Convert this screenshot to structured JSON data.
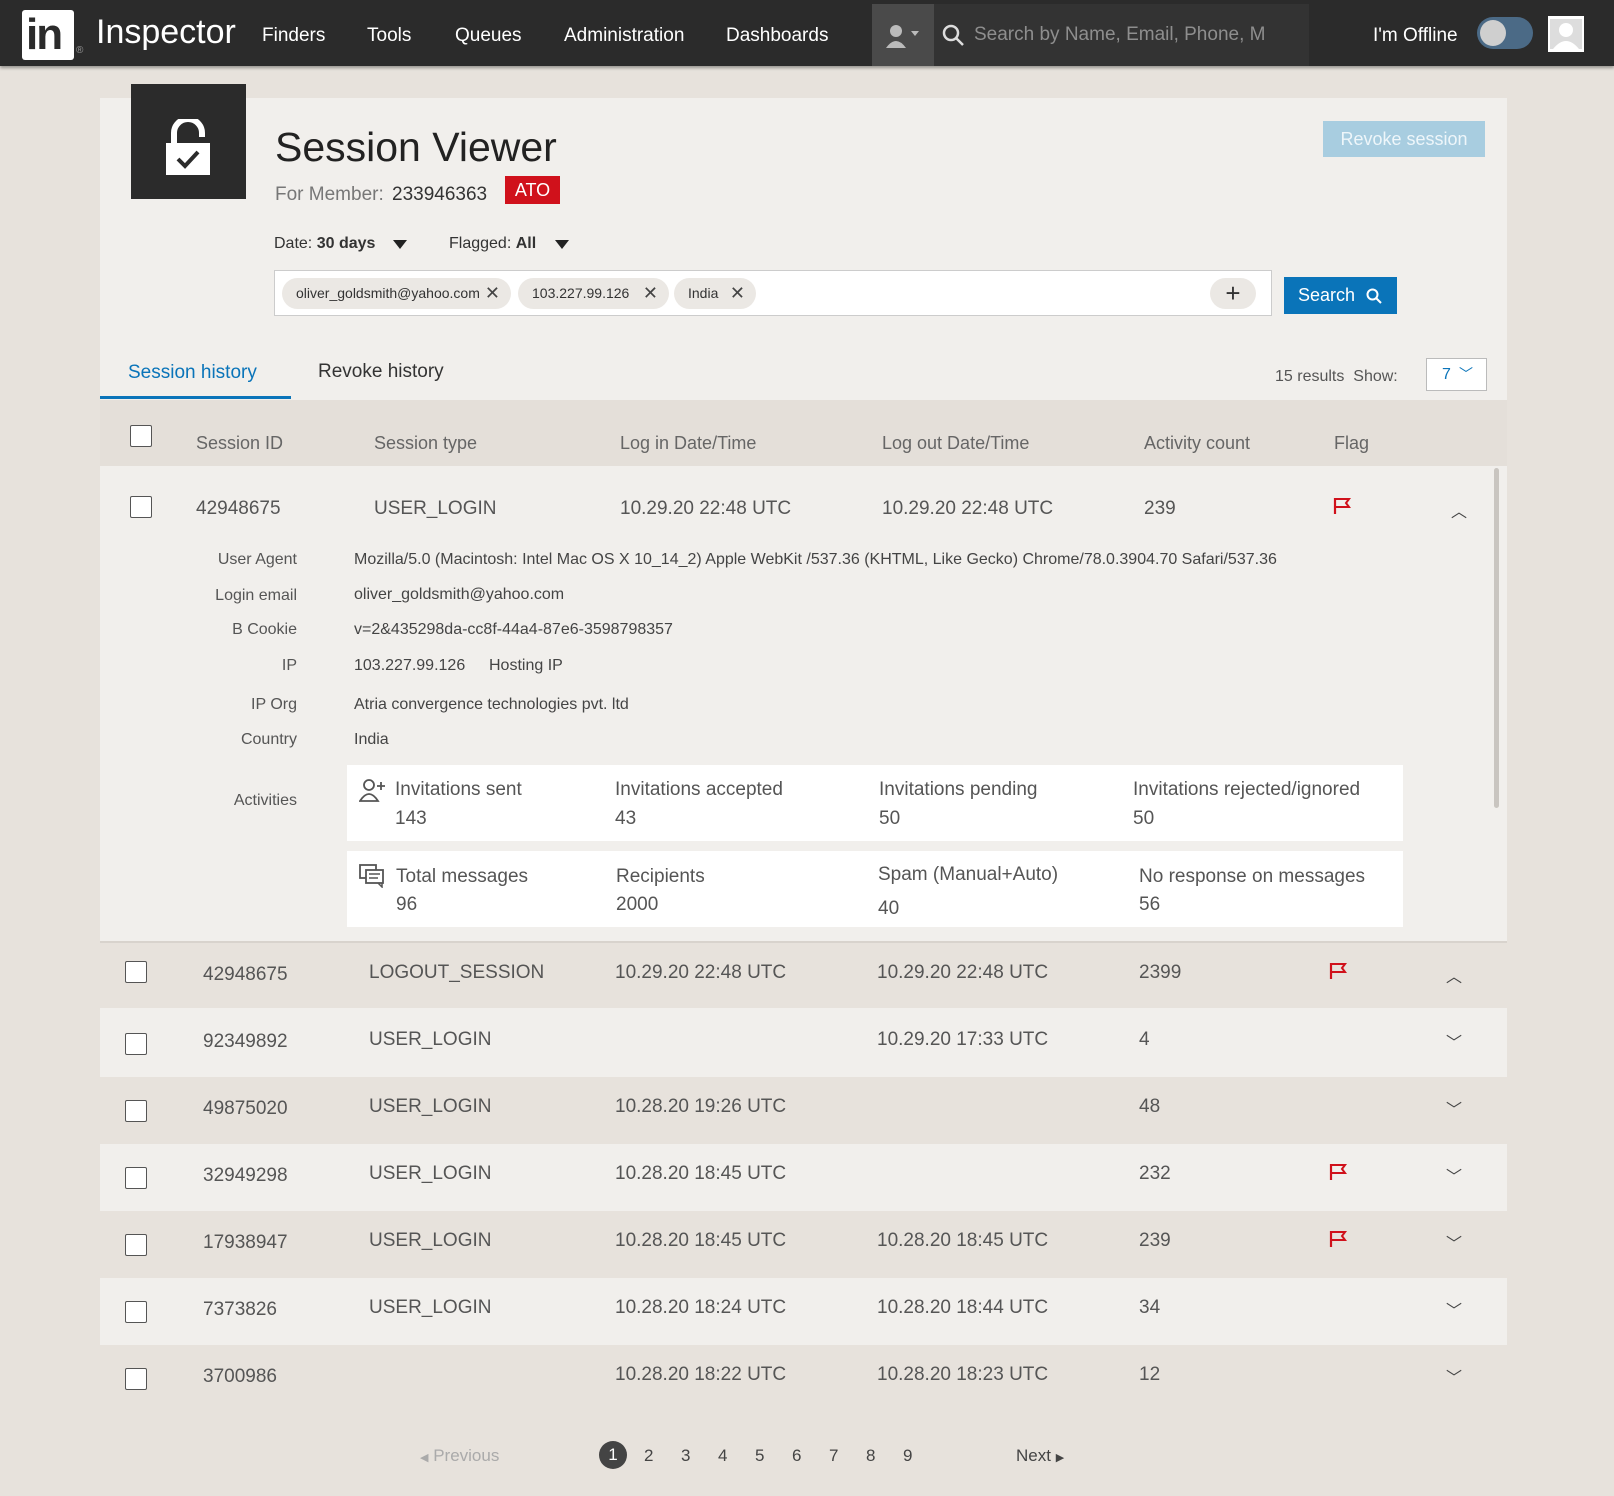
{
  "nav": {
    "logo": "in",
    "app_name": "Inspector",
    "items": [
      "Finders",
      "Tools",
      "Queues",
      "Administration",
      "Dashboards"
    ],
    "search_placeholder": "Search by Name, Email, Phone, M",
    "status_label": "I'm Offline",
    "offline_toggle_on": false
  },
  "header": {
    "title": "Session Viewer",
    "member_label": "For Member:",
    "member_id": "233946363",
    "badge": "ATO",
    "revoke_button": "Revoke session"
  },
  "filters": {
    "date_label": "Date:",
    "date_value": "30 days",
    "flagged_label": "Flagged:",
    "flagged_value": "All",
    "chips": [
      "oliver_goldsmith@yahoo.com",
      "103.227.99.126",
      "India"
    ],
    "search_button": "Search"
  },
  "tabs": {
    "active": "Session history",
    "other": "Revoke history"
  },
  "results": {
    "count_text": "15 results",
    "show_label": "Show:",
    "show_value": "7"
  },
  "table": {
    "headers": [
      "Session ID",
      "Session type",
      "Log in Date/Time",
      "Log out Date/Time",
      "Activity count",
      "Flag"
    ],
    "rows": [
      {
        "id": "42948675",
        "type": "USER_LOGIN",
        "login": "10.29.20 22:48 UTC",
        "logout": "10.29.20 22:48 UTC",
        "count": "239",
        "flag": true,
        "expanded": true
      },
      {
        "id": "42948675",
        "type": "LOGOUT_SESSION",
        "login": "10.29.20 22:48 UTC",
        "logout": "10.29.20 22:48 UTC",
        "count": "2399",
        "flag": true,
        "expanded": true
      },
      {
        "id": "92349892",
        "type": "USER_LOGIN",
        "login": "",
        "logout": "10.29.20 17:33 UTC",
        "count": "4",
        "flag": false,
        "expanded": false
      },
      {
        "id": "49875020",
        "type": "USER_LOGIN",
        "login": "10.28.20 19:26 UTC",
        "logout": "",
        "count": "48",
        "flag": false,
        "expanded": false
      },
      {
        "id": "32949298",
        "type": "USER_LOGIN",
        "login": "10.28.20 18:45 UTC",
        "logout": "",
        "count": "232",
        "flag": true,
        "expanded": false
      },
      {
        "id": "17938947",
        "type": "USER_LOGIN",
        "login": "10.28.20 18:45 UTC",
        "logout": "10.28.20 18:45 UTC",
        "count": "239",
        "flag": true,
        "expanded": false
      },
      {
        "id": "7373826",
        "type": "USER_LOGIN",
        "login": "10.28.20 18:24 UTC",
        "logout": "10.28.20 18:44 UTC",
        "count": "34",
        "flag": false,
        "expanded": false
      },
      {
        "id": "3700986",
        "type": "",
        "login": "10.28.20 18:22 UTC",
        "logout": "10.28.20 18:23 UTC",
        "count": "12",
        "flag": false,
        "expanded": false
      }
    ]
  },
  "details": {
    "user_agent_label": "User Agent",
    "user_agent": "Mozilla/5.0 (Macintosh: Intel Mac OS X  10_14_2) Apple WebKit /537.36 (KHTML, Like Gecko) Chrome/78.0.3904.70 Safari/537.36",
    "login_email_label": "Login email",
    "login_email": "oliver_goldsmith@yahoo.com",
    "bcookie_label": "B Cookie",
    "bcookie": "v=2&435298da-cc8f-44a4-87e6-3598798357",
    "ip_label": "IP",
    "ip": "103.227.99.126",
    "ip_tag": "Hosting IP",
    "iporg_label": "IP Org",
    "iporg": "Atria convergence technologies pvt. ltd",
    "country_label": "Country",
    "country": "India",
    "activities_label": "Activities",
    "invitations": [
      {
        "label": "Invitations sent",
        "value": "143"
      },
      {
        "label": "Invitations accepted",
        "value": "43"
      },
      {
        "label": "Invitations pending",
        "value": "50"
      },
      {
        "label": "Invitations rejected/ignored",
        "value": "50"
      }
    ],
    "messages": [
      {
        "label": "Total messages",
        "value": "96"
      },
      {
        "label": "Recipients",
        "value": "2000"
      },
      {
        "label": "Spam (Manual+Auto)",
        "value": "40"
      },
      {
        "label": "No response on messages",
        "value": "56"
      }
    ]
  },
  "pagination": {
    "previous": "Previous",
    "pages": [
      "1",
      "2",
      "3",
      "4",
      "5",
      "6",
      "7",
      "8",
      "9"
    ],
    "current": "1",
    "next": "Next"
  },
  "colors": {
    "accent": "#0a74b9",
    "alert": "#d0111b",
    "nav_bg": "#2b2b2b"
  }
}
